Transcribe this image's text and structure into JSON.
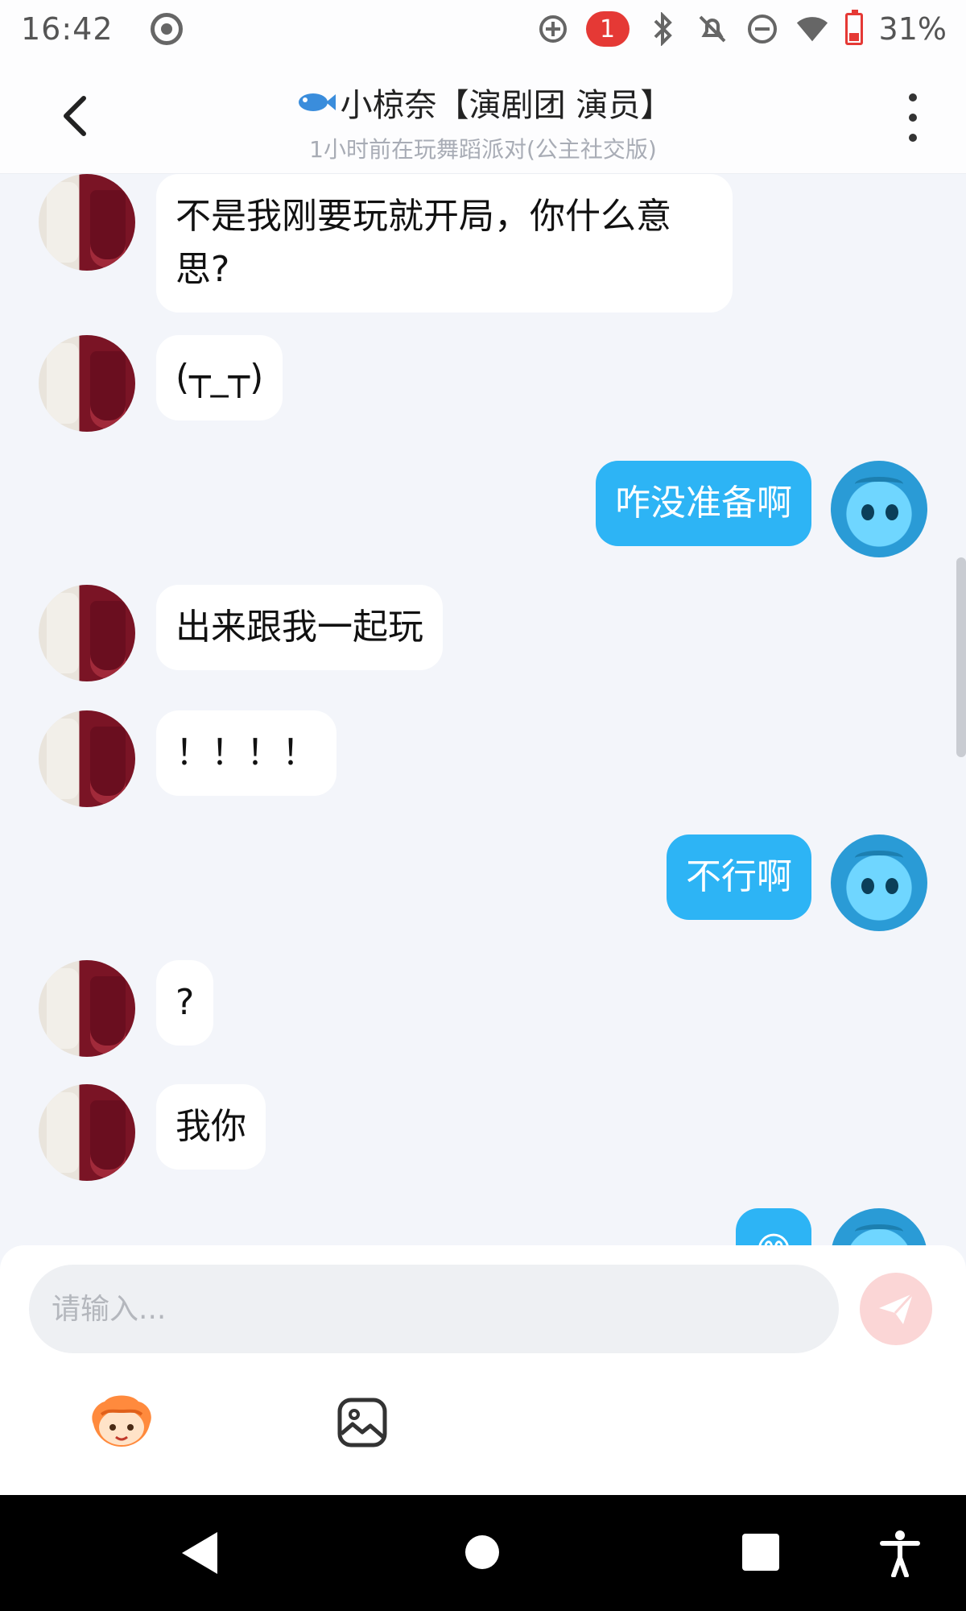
{
  "status_bar": {
    "time": "16:42",
    "notification_count": "1",
    "battery": "31%"
  },
  "header": {
    "back_icon": "chevron-left-icon",
    "title": "小椋奈【演剧团 演员】",
    "subtitle": "1小时前在玩舞蹈派对(公主社交版)",
    "more_icon": "more-vertical-icon"
  },
  "messages": [
    {
      "side": "left",
      "text": "不是我刚要玩就开局，你什么意思?"
    },
    {
      "side": "left",
      "text": "(┬_┬)"
    },
    {
      "side": "right",
      "text": "咋没准备啊"
    },
    {
      "side": "left",
      "text": "出来跟我一起玩"
    },
    {
      "side": "left",
      "text": "！！！！"
    },
    {
      "side": "right",
      "text": "不行啊"
    },
    {
      "side": "left",
      "text": "?"
    },
    {
      "side": "left",
      "text": "我你"
    },
    {
      "side": "right",
      "text": "😊"
    }
  ],
  "input": {
    "placeholder": "请输入..."
  },
  "colors": {
    "my_bubble": "#2db4f5",
    "send_button": "#fbd6d6",
    "notification_badge": "#e53935"
  }
}
